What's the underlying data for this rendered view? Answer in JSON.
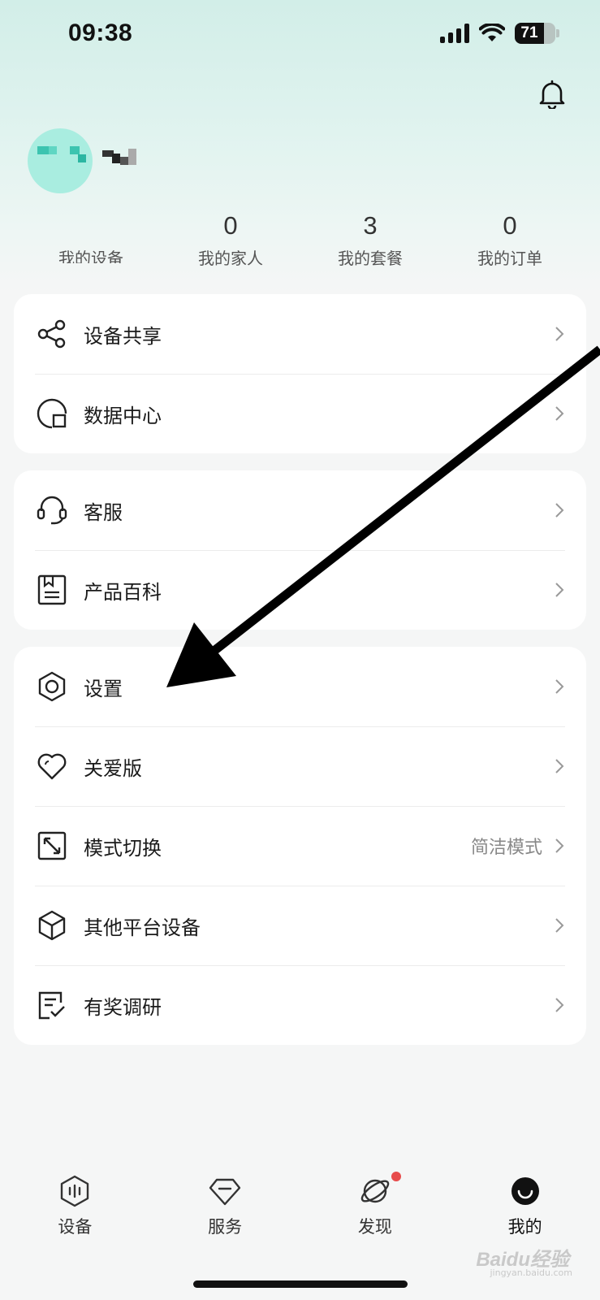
{
  "status_bar": {
    "time": "09:38",
    "battery": "71"
  },
  "profile": {
    "avatar": "avatar-pixelated",
    "username": ""
  },
  "stats": [
    {
      "value": "",
      "label": "我的设备"
    },
    {
      "value": "0",
      "label": "我的家人"
    },
    {
      "value": "3",
      "label": "我的套餐"
    },
    {
      "value": "0",
      "label": "我的订单"
    }
  ],
  "card1": [
    {
      "label": "设备共享",
      "icon": "share-icon"
    },
    {
      "label": "数据中心",
      "icon": "data-center-icon"
    }
  ],
  "card2": [
    {
      "label": "客服",
      "icon": "headset-icon"
    },
    {
      "label": "产品百科",
      "icon": "book-icon"
    }
  ],
  "card3": [
    {
      "label": "设置",
      "icon": "hexagon-settings-icon"
    },
    {
      "label": "关爱版",
      "icon": "heart-icon"
    },
    {
      "label": "模式切换",
      "icon": "mode-switch-icon",
      "value": "简洁模式"
    },
    {
      "label": "其他平台设备",
      "icon": "cube-icon"
    },
    {
      "label": "有奖调研",
      "icon": "survey-icon"
    }
  ],
  "tabs": [
    {
      "label": "设备",
      "icon": "device-tab-icon"
    },
    {
      "label": "服务",
      "icon": "service-tab-icon"
    },
    {
      "label": "发现",
      "icon": "planet-tab-icon",
      "badge": true
    },
    {
      "label": "我的",
      "icon": "smile-tab-icon",
      "active": true
    }
  ],
  "watermark": {
    "text": "Baidu经验",
    "sub": "jingyan.baidu.com"
  },
  "colors": {
    "accent_bg": "#d2eee8",
    "badge": "#e74c4c",
    "arrow": "#000000"
  }
}
